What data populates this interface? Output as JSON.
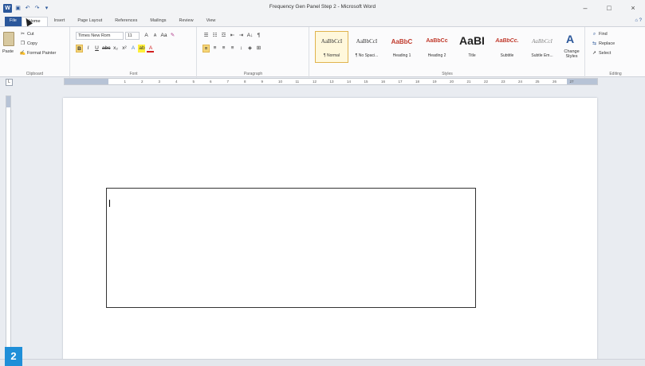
{
  "window": {
    "title": "Frequency Gen Panel Step 2 - Microsoft Word",
    "minimize": "–",
    "maximize": "□",
    "close": "×"
  },
  "qat": {
    "word_logo": "W",
    "save": "▣",
    "undo": "↶",
    "redo": "↷",
    "customize": "▾"
  },
  "tabs": [
    {
      "label": "File"
    },
    {
      "label": "Home"
    },
    {
      "label": "Insert"
    },
    {
      "label": "Page Layout"
    },
    {
      "label": "References"
    },
    {
      "label": "Mailings"
    },
    {
      "label": "Review"
    },
    {
      "label": "View"
    }
  ],
  "help": "⌂ ?",
  "clipboard": {
    "paste": "Paste",
    "cut": "Cut",
    "copy": "Copy",
    "format_painter": "Format Painter",
    "label": "Clipboard"
  },
  "font": {
    "family": "Times New Rom",
    "size": "11",
    "grow": "A",
    "shrink": "A",
    "change_case": "Aa",
    "clear": "✎",
    "bold": "B",
    "italic": "I",
    "underline": "U",
    "strike": "abc",
    "subscript": "x₂",
    "superscript": "x²",
    "text_effects": "A",
    "highlight": "ab",
    "font_color": "A",
    "label": "Font"
  },
  "paragraph": {
    "bullets": "☰",
    "numbering": "☷",
    "multilevel": "☲",
    "decrease_indent": "⇤",
    "increase_indent": "⇥",
    "sort": "A↓",
    "show_marks": "¶",
    "align_left": "≡",
    "center": "≡",
    "align_right": "≡",
    "justify": "≡",
    "line_spacing": "↕",
    "shading": "◈",
    "borders": "⊞",
    "label": "Paragraph"
  },
  "styles": {
    "items": [
      {
        "sample": "AaBbCcI",
        "name": "¶ Normal"
      },
      {
        "sample": "AaBbCcI",
        "name": "¶ No Spaci..."
      },
      {
        "sample": "AaBbC",
        "name": "Heading 1"
      },
      {
        "sample": "AaBbCc",
        "name": "Heading 2"
      },
      {
        "sample": "AaBI",
        "name": "Title"
      },
      {
        "sample": "AaBbCc.",
        "name": "Subtitle"
      },
      {
        "sample": "AaBbCcI",
        "name": "Subtle Em..."
      }
    ],
    "change_styles": "Change Styles",
    "label": "Styles"
  },
  "editing": {
    "find": "Find",
    "replace": "Replace",
    "select": "Select",
    "label": "Editing"
  },
  "ruler": {
    "numbers": [
      "1",
      "2",
      "3",
      "4",
      "5",
      "6",
      "7",
      "8",
      "9",
      "10",
      "11",
      "12",
      "13",
      "14",
      "15",
      "16",
      "17",
      "18",
      "19",
      "20",
      "21",
      "22",
      "23",
      "24",
      "25",
      "26",
      "27"
    ]
  },
  "step_badge": "2",
  "colors": {
    "accent": "#2b579a",
    "highlight": "#f6d77a",
    "badge": "#1f8fd8"
  }
}
